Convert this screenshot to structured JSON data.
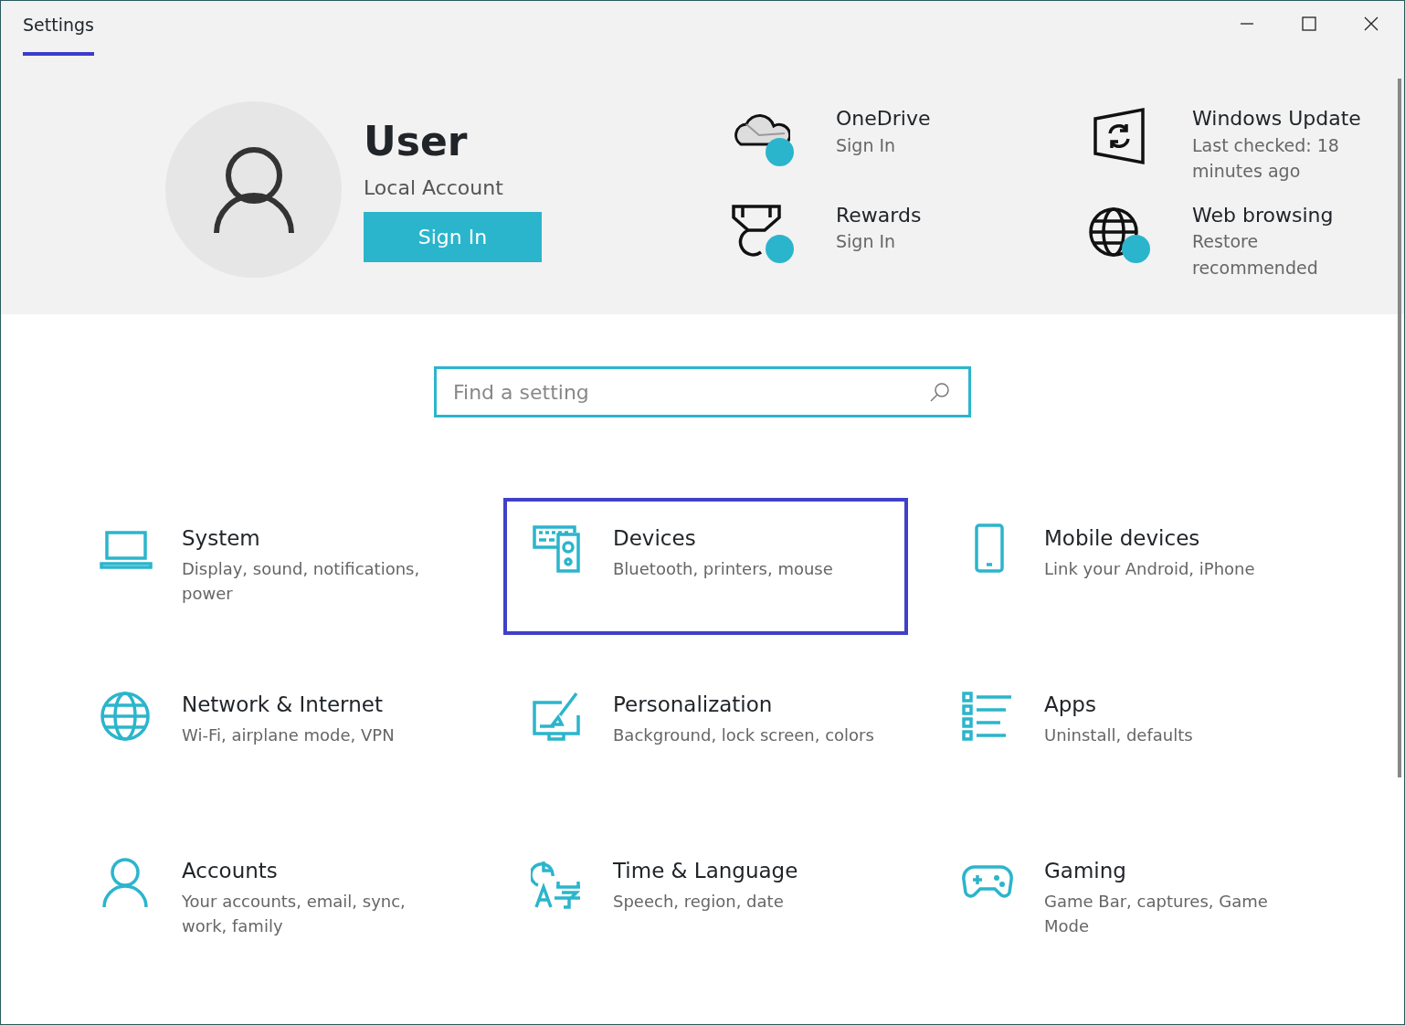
{
  "window": {
    "title": "Settings"
  },
  "account": {
    "name": "User",
    "type": "Local Account",
    "sign_in_button": "Sign In"
  },
  "services": [
    {
      "kind": "cloud",
      "title": "OneDrive",
      "subtitle": "Sign In",
      "alert": true
    },
    {
      "kind": "update",
      "title": "Windows Update",
      "subtitle": "Last checked: 18 minutes ago",
      "alert": false
    },
    {
      "kind": "medal",
      "title": "Rewards",
      "subtitle": "Sign In",
      "alert": true
    },
    {
      "kind": "globe",
      "title": "Web browsing",
      "subtitle": "Restore recommended",
      "alert": true
    }
  ],
  "search": {
    "placeholder": "Find a setting"
  },
  "categories": [
    {
      "kind": "laptop",
      "title": "System",
      "description": "Display, sound, notifications, power",
      "selected": false
    },
    {
      "kind": "devices",
      "title": "Devices",
      "description": "Bluetooth, printers, mouse",
      "selected": true
    },
    {
      "kind": "phone",
      "title": "Mobile devices",
      "description": "Link your Android, iPhone",
      "selected": false
    },
    {
      "kind": "globe",
      "title": "Network & Internet",
      "description": "Wi-Fi, airplane mode, VPN",
      "selected": false
    },
    {
      "kind": "brush",
      "title": "Personalization",
      "description": "Background, lock screen, colors",
      "selected": false
    },
    {
      "kind": "apps",
      "title": "Apps",
      "description": "Uninstall, defaults",
      "selected": false
    },
    {
      "kind": "person",
      "title": "Accounts",
      "description": "Your accounts, email, sync, work, family",
      "selected": false
    },
    {
      "kind": "time",
      "title": "Time & Language",
      "description": "Speech, region, date",
      "selected": false
    },
    {
      "kind": "gamepad",
      "title": "Gaming",
      "description": "Game Bar, captures, Game Mode",
      "selected": false
    }
  ]
}
